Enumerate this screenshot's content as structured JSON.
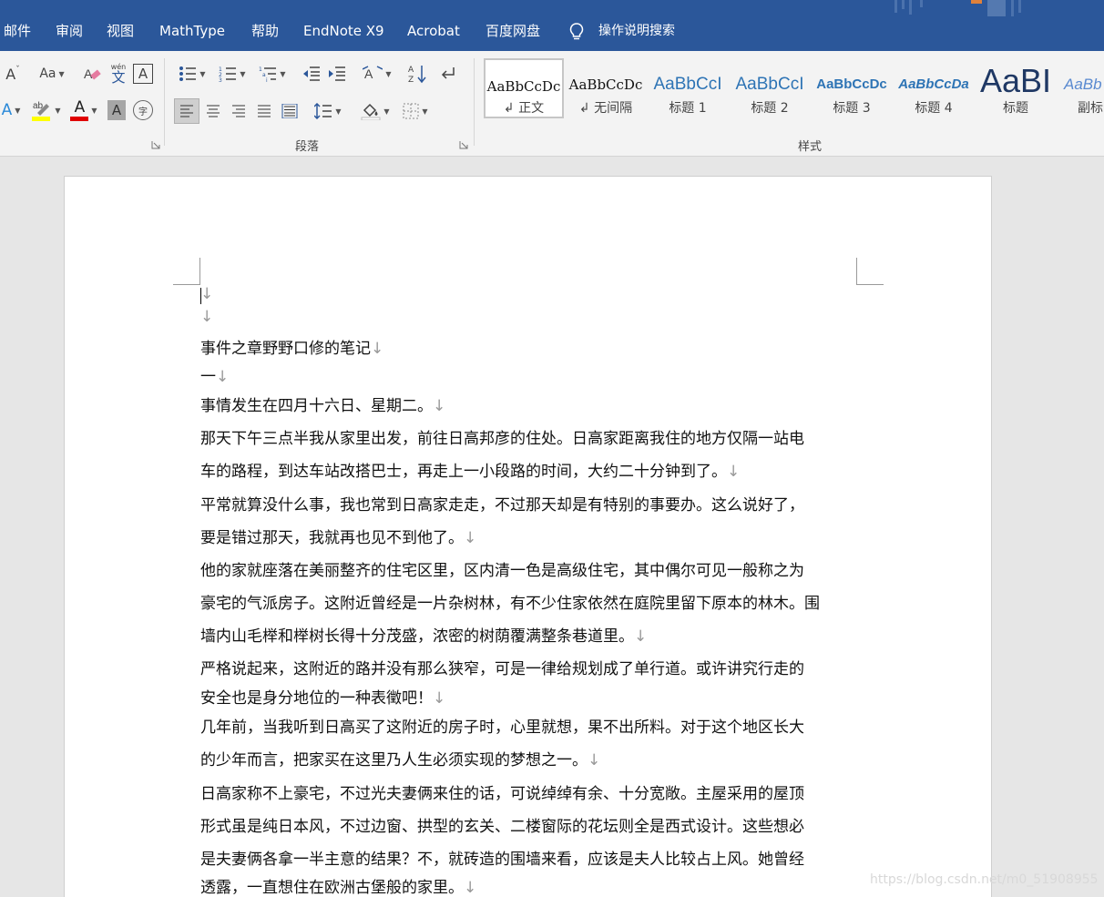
{
  "menu": {
    "items": [
      "邮件",
      "审阅",
      "视图",
      "MathType",
      "帮助",
      "EndNote X9",
      "Acrobat",
      "百度网盘"
    ],
    "search_label": "操作说明搜索"
  },
  "ribbon": {
    "font": {
      "change_case_label": "Aa",
      "phonetic_label": "wén",
      "phonetic_char": "文",
      "char_border_label": "A",
      "font_color_label": "A",
      "char_shading_label": "A",
      "enclose_char_label": "字"
    },
    "paragraph": {
      "group_label": "段落"
    },
    "styles": {
      "group_label": "样式",
      "items": [
        {
          "sample": "AaBbCcDc",
          "name": "正文",
          "marker": "↲"
        },
        {
          "sample": "AaBbCcDc",
          "name": "无间隔",
          "marker": "↲"
        },
        {
          "sample": "AaBbCcI",
          "name": "标题 1"
        },
        {
          "sample": "AaBbCcI",
          "name": "标题 2"
        },
        {
          "sample": "AaBbCcDc",
          "name": "标题 3"
        },
        {
          "sample": "AaBbCcDa",
          "name": "标题 4"
        },
        {
          "sample": "AaBI",
          "name": "标题"
        },
        {
          "sample": "AaBb",
          "name": "副标"
        }
      ]
    },
    "colors": {
      "highlight": "#ffff00",
      "font_color": "#e00000"
    }
  },
  "document": {
    "paragraph_mark": "↓",
    "paragraphs": [
      "",
      "",
      "事件之章野野口修的笔记",
      "一",
      "事情发生在四月十六日、星期二。",
      "那天下午三点半我从家里出发，前往日高邦彦的住处。日高家距离我住的地方仅隔一站电",
      "车的路程，到达车站改搭巴士，再走上一小段路的时间，大约二十分钟到了。",
      "平常就算没什么事，我也常到日高家走走，不过那天却是有特别的事要办。这么说好了，",
      "要是错过那天，我就再也见不到他了。",
      "他的家就座落在美丽整齐的住宅区里，区内清一色是高级住宅，其中偶尔可见一般称之为",
      "豪宅的气派房子。这附近曾经是一片杂树林，有不少住家依然在庭院里留下原本的林木。围",
      "墙内山毛榉和榉树长得十分茂盛，浓密的树荫覆满整条巷道里。",
      "严格说起来，这附近的路并没有那么狭窄，可是一律给规划成了单行道。或许讲究行走的",
      "安全也是身分地位的一种表徵吧！",
      "几年前，当我听到日高买了这附近的房子时，心里就想，果不出所料。对于这个地区长大",
      "的少年而言，把家买在这里乃人生必须实现的梦想之一。",
      "日高家称不上豪宅，不过光夫妻俩来住的话，可说绰绰有余、十分宽敞。主屋采用的屋顶",
      "形式虽是纯日本风，不过边窗、拱型的玄关、二楼窗际的花坛则全是西式设计。这些想必",
      "是夫妻俩各拿一半主意的结果？不，就砖造的围墙来看，应该是夫人比较占上风。她曾经",
      "透露，一直想住在欧洲古堡般的家里。"
    ]
  },
  "watermark": "https://blog.csdn.net/m0_51908955"
}
